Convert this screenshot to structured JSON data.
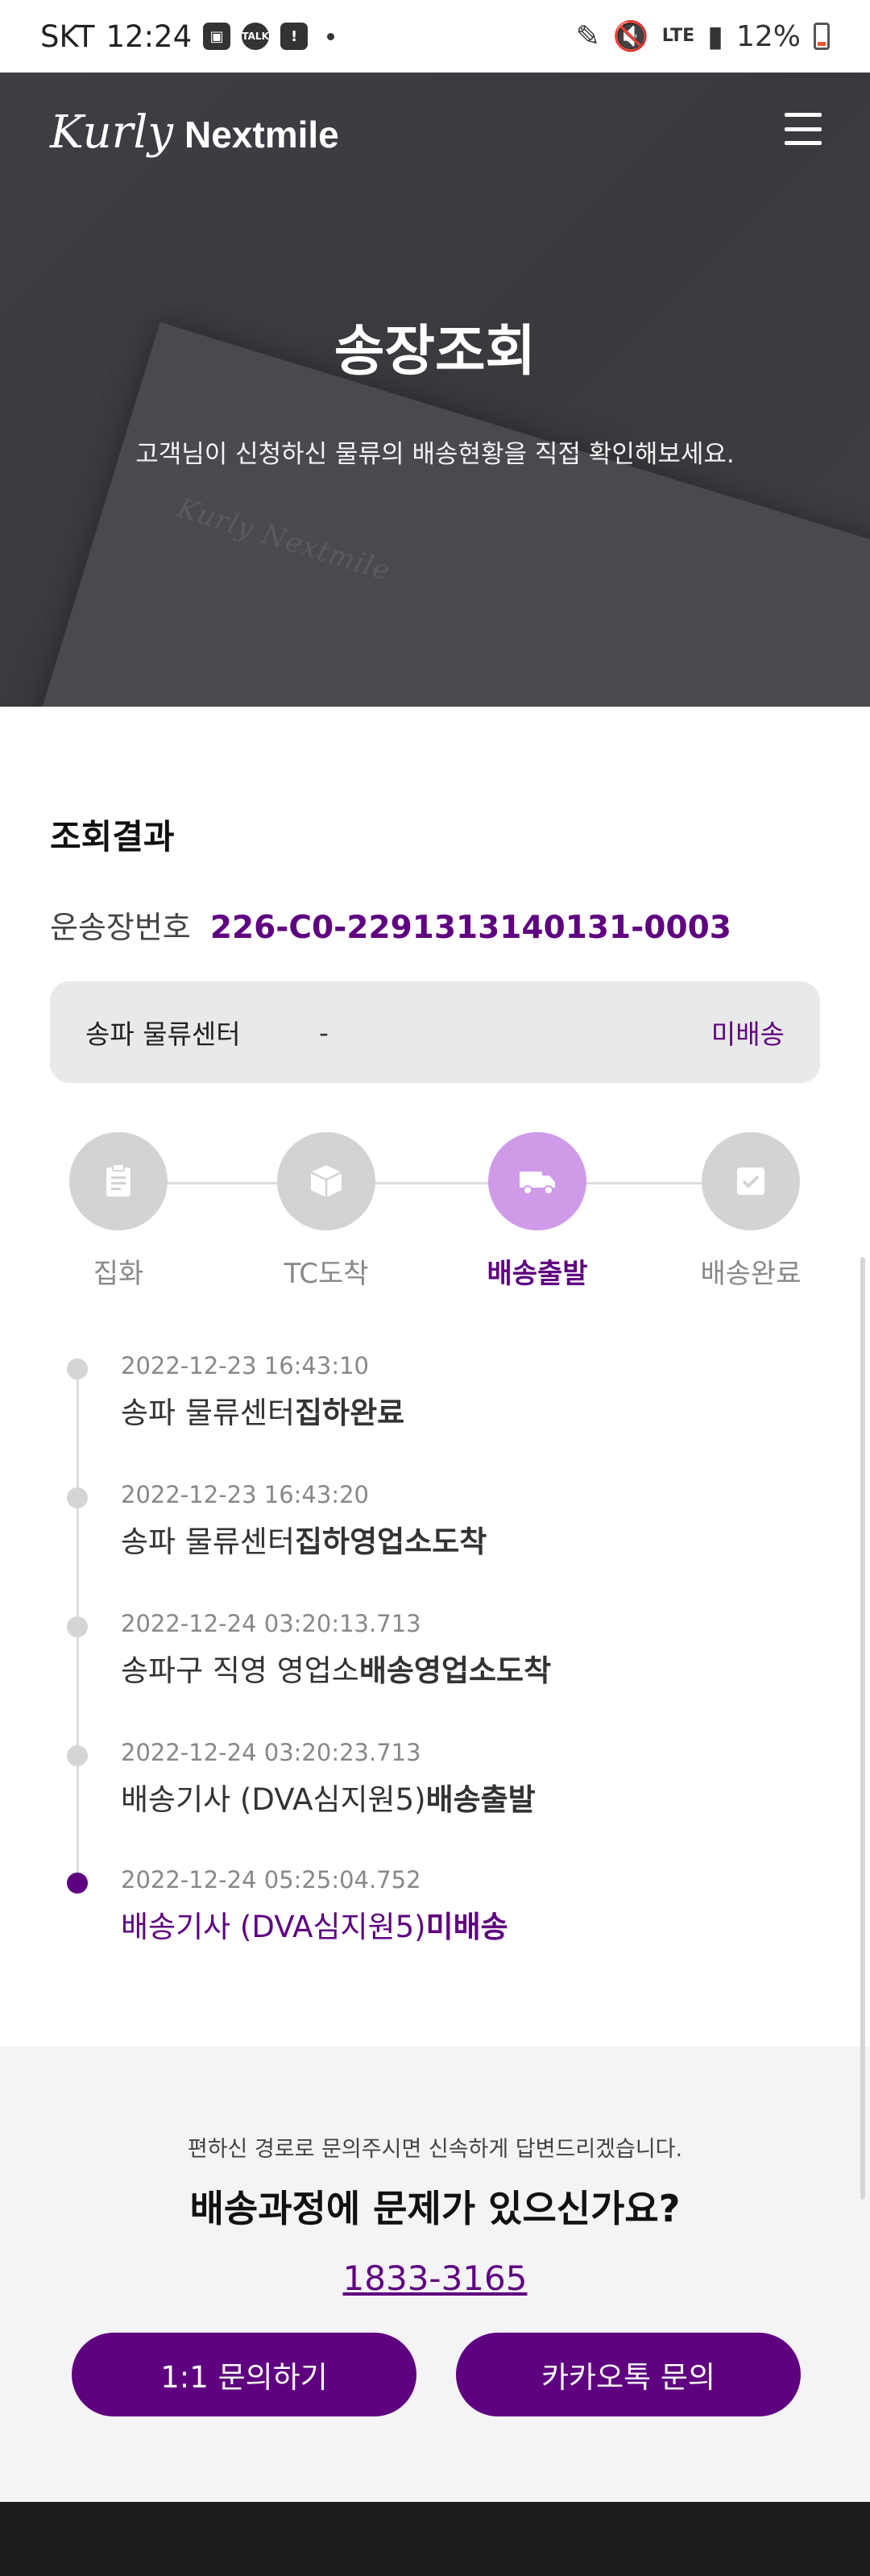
{
  "status_bar": {
    "carrier": "SKT",
    "time": "12:24",
    "notification_icons": [
      "image-icon",
      "talk-icon",
      "alert-icon"
    ],
    "talk_badge": "TALK",
    "network": "LTE",
    "battery": "12%",
    "battery_level": 0.12
  },
  "header": {
    "logo_script": "Kurly",
    "logo_word": "Nextmile",
    "menu_icon": "hamburger-icon"
  },
  "hero": {
    "title": "송장조회",
    "subtitle": "고객님이 신청하신 물류의 배송현황을 직접 확인해보세요."
  },
  "result": {
    "section_title": "조회결과",
    "waybill_label": "운송장번호",
    "waybill_number": "226-C0-2291313140131-0003",
    "center": {
      "name": "송파 물류센터",
      "value": "-",
      "status": "미배송"
    },
    "steps": [
      {
        "label": "집화",
        "icon": "clipboard-icon",
        "active": false
      },
      {
        "label": "TC도착",
        "icon": "box-icon",
        "active": false
      },
      {
        "label": "배송출발",
        "icon": "truck-icon",
        "active": true
      },
      {
        "label": "배송완료",
        "icon": "check-icon",
        "active": false
      }
    ],
    "timeline": [
      {
        "time": "2022-12-23 16:43:10",
        "text": "송파 물류센터",
        "event": "집하완료"
      },
      {
        "time": "2022-12-23 16:43:20",
        "text": "송파 물류센터",
        "event": "집하영업소도착"
      },
      {
        "time": "2022-12-24 03:20:13.713",
        "text": "송파구 직영 영업소",
        "event": "배송영업소도착"
      },
      {
        "time": "2022-12-24 03:20:23.713",
        "text": "배송기사 (DVA심지원5)",
        "event": "배송출발"
      },
      {
        "time": "2022-12-24 05:25:04.752",
        "text": "배송기사 (DVA심지원5)",
        "event": "미배송"
      }
    ]
  },
  "help": {
    "subtitle": "편하신 경로로 문의주시면 신속하게 답변드리겠습니다.",
    "title": "배송과정에 문제가 있으신가요?",
    "phone": "1833-3165",
    "inquiry_button": "1:1 문의하기",
    "kakao_button": "카카오톡 문의"
  },
  "colors": {
    "brand_purple": "#5f0080",
    "active_step": "#cf9be9",
    "hero_bg": "#3f3e44"
  }
}
